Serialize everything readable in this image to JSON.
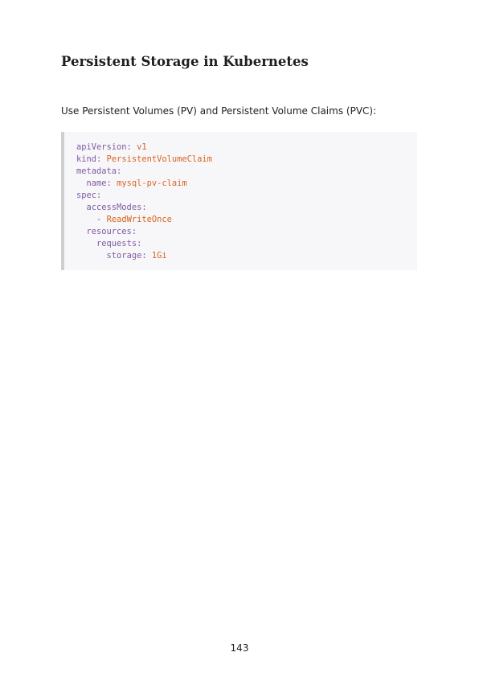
{
  "heading": "Persistent Storage in Kubernetes",
  "intro": "Use Persistent Volumes (PV) and Persistent Volume Claims (PVC):",
  "code": {
    "lines": [
      {
        "indent": "",
        "key": "apiVersion:",
        "value": "v1"
      },
      {
        "indent": "",
        "key": "kind:",
        "value": "PersistentVolumeClaim"
      },
      {
        "indent": "",
        "key": "metadata:",
        "value": ""
      },
      {
        "indent": "  ",
        "key": "name:",
        "value": "mysql-pv-claim"
      },
      {
        "indent": "",
        "key": "spec:",
        "value": ""
      },
      {
        "indent": "  ",
        "key": "accessModes:",
        "value": ""
      },
      {
        "indent": "    ",
        "key": "-",
        "value": "ReadWriteOnce"
      },
      {
        "indent": "  ",
        "key": "resources:",
        "value": ""
      },
      {
        "indent": "    ",
        "key": "requests:",
        "value": ""
      },
      {
        "indent": "      ",
        "key": "storage:",
        "value": "1Gi"
      }
    ],
    "colors": {
      "key": "#7e5aa2",
      "value": "#d9631f",
      "background": "#f7f7f9",
      "border": "#cfcfcf"
    }
  },
  "page_number": "143"
}
